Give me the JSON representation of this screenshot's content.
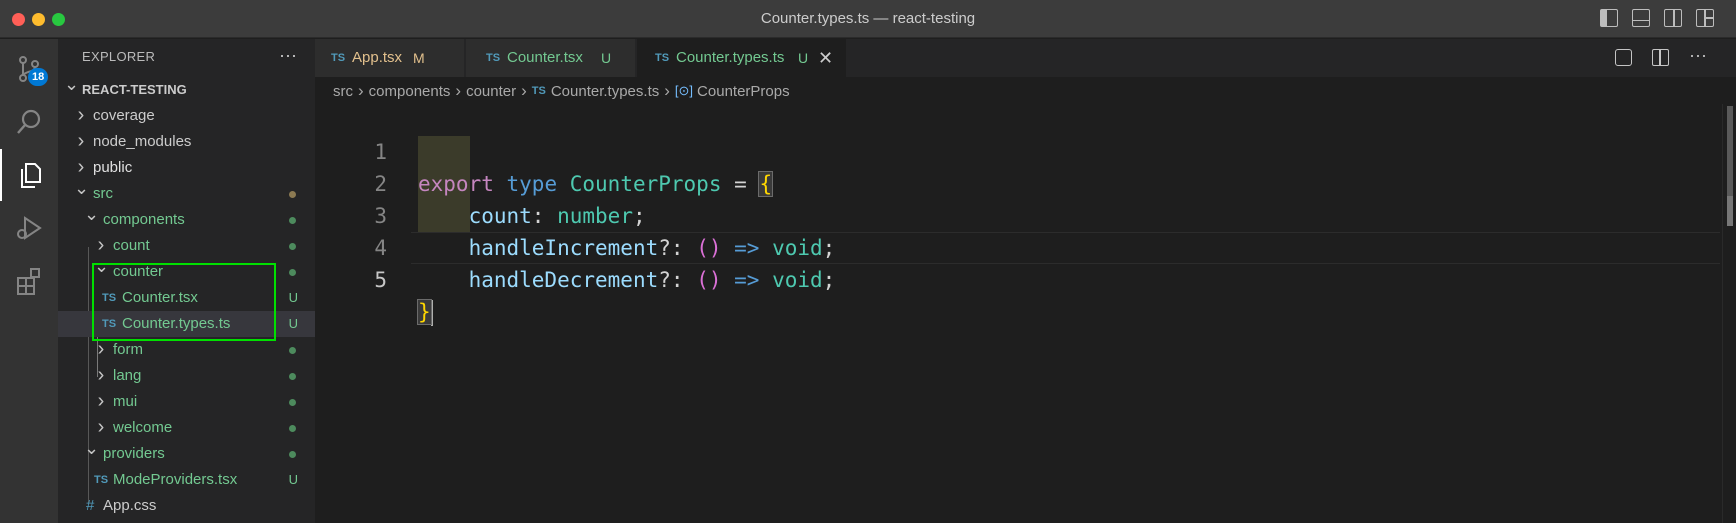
{
  "window": {
    "title": "Counter.types.ts — react-testing"
  },
  "activity_bar": {
    "items": [
      {
        "name": "source-control",
        "icon": "source-control-icon",
        "badge": "18"
      },
      {
        "name": "search",
        "icon": "search-icon"
      },
      {
        "name": "explorer",
        "icon": "files-icon",
        "active": true
      },
      {
        "name": "run-debug",
        "icon": "run-debug-icon"
      },
      {
        "name": "extensions",
        "icon": "extensions-icon"
      }
    ]
  },
  "sidebar": {
    "header": "EXPLORER",
    "more": "···",
    "root": "REACT-TESTING",
    "items": [
      {
        "label": "coverage"
      },
      {
        "label": "node_modules"
      },
      {
        "label": "public"
      },
      {
        "label": "src"
      },
      {
        "label": "components"
      },
      {
        "label": "count"
      },
      {
        "label": "counter"
      },
      {
        "label": "Counter.tsx",
        "file_icon": "TS",
        "status": "U"
      },
      {
        "label": "Counter.types.ts",
        "file_icon": "TS",
        "status": "U"
      },
      {
        "label": "form"
      },
      {
        "label": "lang"
      },
      {
        "label": "mui"
      },
      {
        "label": "welcome"
      },
      {
        "label": "providers"
      },
      {
        "label": "ModeProviders.tsx",
        "file_icon": "TS",
        "status": "U"
      },
      {
        "label": "App.css",
        "file_icon": "#"
      }
    ]
  },
  "tabs": [
    {
      "icon": "TS",
      "label": "App.tsx",
      "status": "M"
    },
    {
      "icon": "TS",
      "label": "Counter.tsx",
      "status": "U"
    },
    {
      "icon": "TS",
      "label": "Counter.types.ts",
      "status": "U",
      "close": "✕"
    }
  ],
  "breadcrumb": {
    "parts": [
      "src",
      "components",
      "counter",
      "Counter.types.ts",
      "CounterProps"
    ],
    "file_icon": "TS",
    "symbol_icon": "[⊙]"
  },
  "editor": {
    "line_numbers": [
      "1",
      "2",
      "3",
      "4",
      "5"
    ],
    "tokens": {
      "export": "export",
      "type": "type",
      "CounterProps": "CounterProps",
      "eq": "=",
      "lbrace": "{",
      "count": "count",
      "colon": ":",
      "number": "number",
      "semi": ";",
      "handleIncrement": "handleIncrement",
      "optcolon": "?:",
      "parens": "()",
      "arrow": "=>",
      "void": "void",
      "handleDecrement": "handleDecrement",
      "rbrace": "}"
    }
  },
  "colors": {
    "accent": "#0078d4",
    "untracked": "#73c991",
    "modified": "#e2c08d",
    "highlight_box": "#00e000"
  }
}
